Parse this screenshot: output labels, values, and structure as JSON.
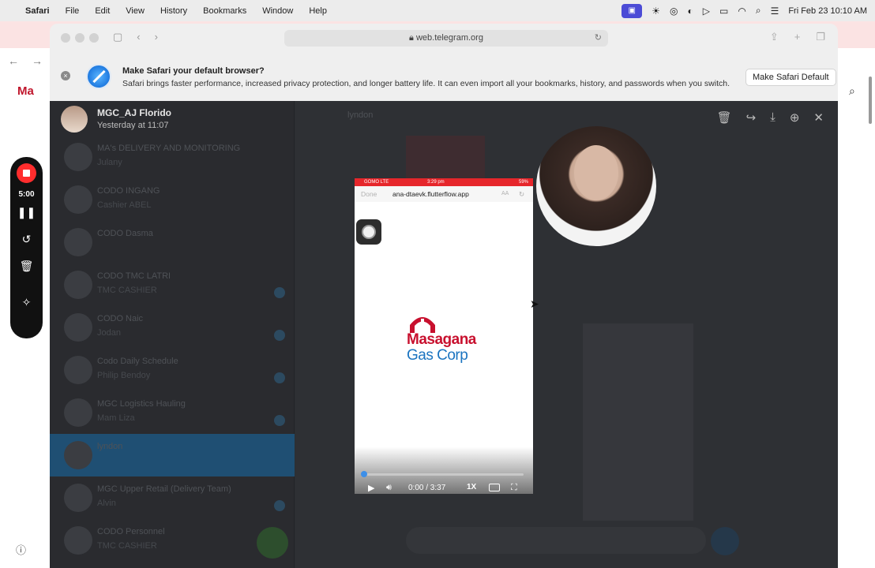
{
  "menubar": {
    "app_name": "Safari",
    "menus": [
      "File",
      "Edit",
      "View",
      "History",
      "Bookmarks",
      "Window",
      "Help"
    ],
    "datetime": "Fri Feb 23  10:10 AM"
  },
  "background_page": {
    "logo_text": "Ma"
  },
  "safari": {
    "url": "web.telegram.org",
    "banner": {
      "title": "Make Safari your default browser?",
      "text": "Safari brings faster performance, increased privacy protection, and longer battery life. It can even import all your bookmarks, history, and passwords when you switch.",
      "button": "Make Safari Default"
    }
  },
  "telegram": {
    "chats": [
      {
        "name": "MA's DELIVERY AND MONITORING",
        "last": "Julany"
      },
      {
        "name": "CODO INGANG",
        "last": "Cashier ABEL"
      },
      {
        "name": "CODO Dasma",
        "last": ""
      },
      {
        "name": "CODO TMC LATRI",
        "last": "TMC CASHIER"
      },
      {
        "name": "CODO Naic",
        "last": "Jodan"
      },
      {
        "name": "Codo Daily Schedule",
        "last": "Philip Bendoy"
      },
      {
        "name": "MGC Logistics Hauling",
        "last": "Mam Liza"
      },
      {
        "name": "lyndon",
        "last": ""
      },
      {
        "name": "MGC Upper Retail (Delivery Team)",
        "last": "Alvin"
      },
      {
        "name": "CODO Personnel",
        "last": "TMC CASHIER"
      }
    ],
    "chat_header_name": "lyndon"
  },
  "viewer": {
    "sender_name": "MGC_AJ Florido",
    "sender_date": "Yesterday at 11:07",
    "actions": [
      "delete-icon",
      "forward-icon",
      "download-icon",
      "zoom-icon",
      "close-icon"
    ]
  },
  "video": {
    "phone_status": {
      "carrier": "GOMO  LTE",
      "time": "3:29 pm",
      "battery": "59%"
    },
    "phone_url": {
      "done": "Done",
      "address": "ana-dtaevk.flutterflow.app",
      "aa": "AA"
    },
    "brand_line1": "Masagana",
    "brand_line2": "Gas Corp",
    "time_display": "0:00 / 3:37",
    "speed": "1X",
    "progress": 0.0
  },
  "recorder": {
    "time": "5:00"
  },
  "colors": {
    "brand_red": "#c8102e",
    "brand_blue": "#1b74c0",
    "record_red": "#ff2d2d",
    "progress_blue": "#3d8fe8"
  }
}
